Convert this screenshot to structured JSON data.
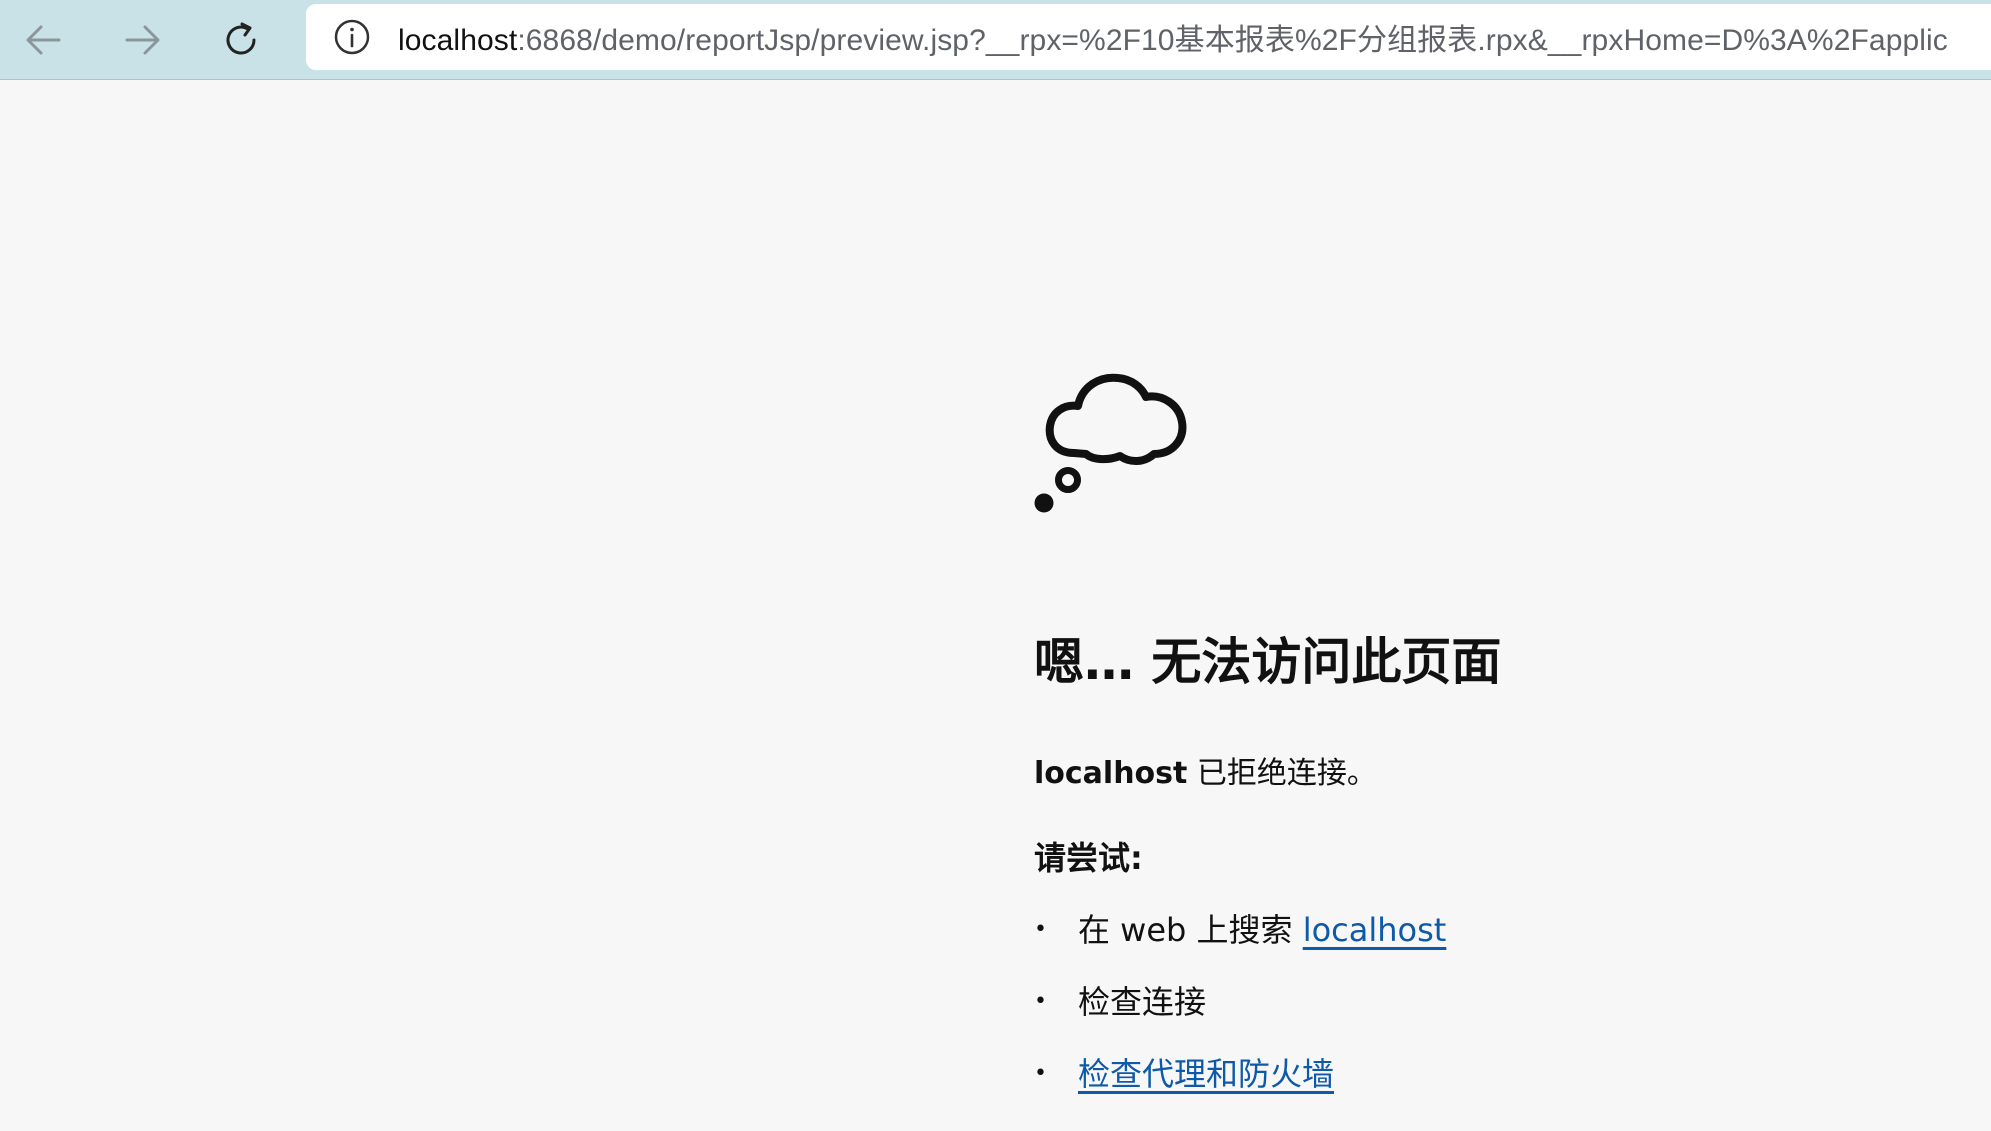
{
  "browser": {
    "url_host": "localhost",
    "url_rest": ":6868/demo/reportJsp/preview.jsp?__rpx=%2F10基本报表%2F分组报表.rpx&__rpxHome=D%3A%2Fapplic",
    "icons": {
      "back": "arrow-left-icon",
      "forward": "arrow-right-icon",
      "refresh": "refresh-icon",
      "info": "info-icon"
    }
  },
  "error_page": {
    "icon": "thought-cloud-icon",
    "title": "嗯… 无法访问此页面",
    "host": "localhost",
    "message": " 已拒绝连接。",
    "try_label": "请尝试:",
    "suggestions": [
      {
        "prefix": "在 web 上搜索 ",
        "link": "localhost"
      },
      {
        "text": "检查连接"
      },
      {
        "link": "检查代理和防火墙"
      }
    ],
    "bullet": "•",
    "link_color": "#0f5aa8"
  },
  "colors": {
    "toolbar_bg": "#c9e2e7",
    "page_bg": "#f7f7f7"
  }
}
